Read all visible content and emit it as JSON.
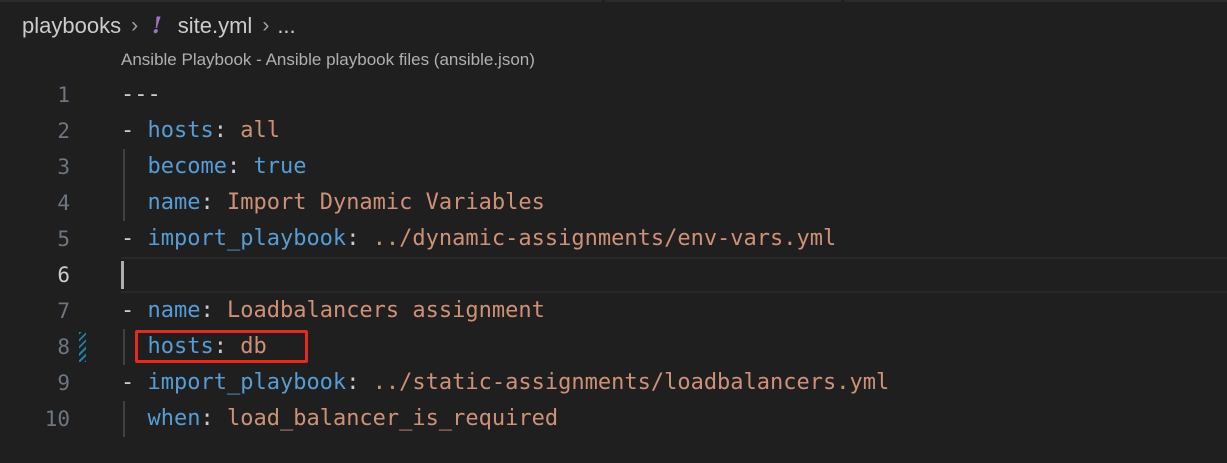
{
  "breadcrumb": {
    "folder": "playbooks",
    "separator": "›",
    "file_icon": "!",
    "file": "site.yml",
    "more": "..."
  },
  "codelens": "Ansible Playbook - Ansible playbook files (ansible.json)",
  "colors": {
    "key": "#569cd6",
    "string": "#ce9178",
    "boolean": "#569cd6",
    "punctuation": "#cccccc",
    "yaml_icon": "#a074c4",
    "highlight_box": "#e32b20",
    "modified_gutter": "#1b81a8"
  },
  "lines": [
    {
      "num": "1",
      "tokens": [
        {
          "t": "---",
          "c": "punct"
        }
      ]
    },
    {
      "num": "2",
      "tokens": [
        {
          "t": "- ",
          "c": "punct"
        },
        {
          "t": "hosts",
          "c": "key"
        },
        {
          "t": ": ",
          "c": "punct"
        },
        {
          "t": "all",
          "c": "str"
        }
      ]
    },
    {
      "num": "3",
      "tokens": [
        {
          "t": "  ",
          "c": "punct"
        },
        {
          "t": "become",
          "c": "key"
        },
        {
          "t": ": ",
          "c": "punct"
        },
        {
          "t": "true",
          "c": "bool"
        }
      ]
    },
    {
      "num": "4",
      "tokens": [
        {
          "t": "  ",
          "c": "punct"
        },
        {
          "t": "name",
          "c": "key"
        },
        {
          "t": ": ",
          "c": "punct"
        },
        {
          "t": "Import Dynamic Variables",
          "c": "str"
        }
      ]
    },
    {
      "num": "5",
      "tokens": [
        {
          "t": "- ",
          "c": "punct"
        },
        {
          "t": "import_playbook",
          "c": "key"
        },
        {
          "t": ": ",
          "c": "punct"
        },
        {
          "t": "../dynamic-assignments/env-vars.yml",
          "c": "str"
        }
      ]
    },
    {
      "num": "6",
      "tokens": []
    },
    {
      "num": "7",
      "tokens": [
        {
          "t": "- ",
          "c": "punct"
        },
        {
          "t": "name",
          "c": "key"
        },
        {
          "t": ": ",
          "c": "punct"
        },
        {
          "t": "Loadbalancers assignment",
          "c": "str"
        }
      ]
    },
    {
      "num": "8",
      "tokens": [
        {
          "t": "  ",
          "c": "punct"
        },
        {
          "t": "hosts",
          "c": "key"
        },
        {
          "t": ": ",
          "c": "punct"
        },
        {
          "t": "db",
          "c": "str"
        }
      ]
    },
    {
      "num": "9",
      "tokens": [
        {
          "t": "- ",
          "c": "punct"
        },
        {
          "t": "import_playbook",
          "c": "key"
        },
        {
          "t": ": ",
          "c": "punct"
        },
        {
          "t": "../static-assignments/loadbalancers.yml",
          "c": "str"
        }
      ]
    },
    {
      "num": "10",
      "tokens": [
        {
          "t": "  ",
          "c": "punct"
        },
        {
          "t": "when",
          "c": "key"
        },
        {
          "t": ": ",
          "c": "punct"
        },
        {
          "t": "load_balancer_is_required",
          "c": "str"
        }
      ]
    }
  ],
  "current_line": "6",
  "modified_line": "8"
}
